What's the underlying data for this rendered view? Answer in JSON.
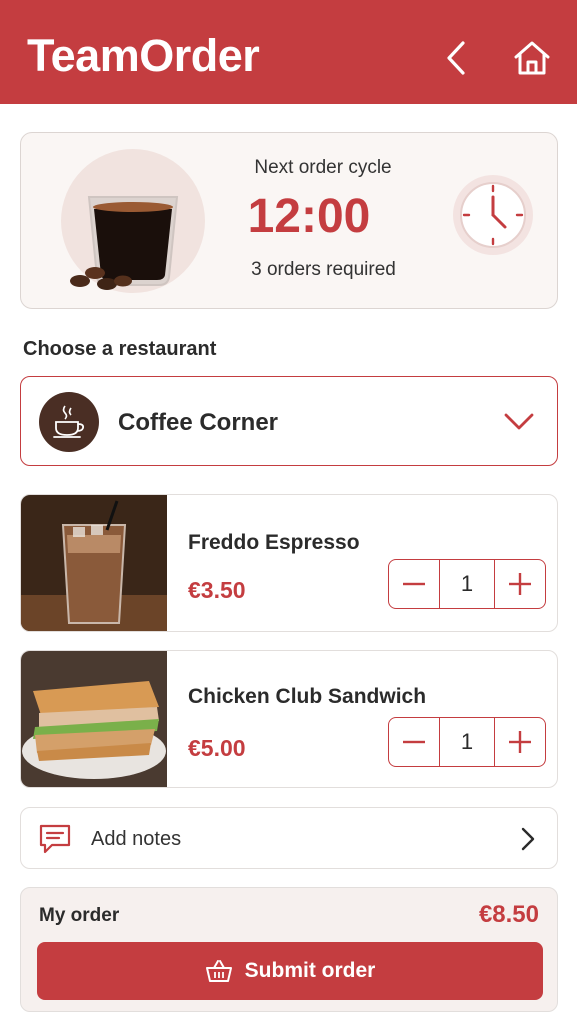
{
  "header": {
    "title": "TeamOrder",
    "back_icon": "chevron-left-icon",
    "home_icon": "home-icon",
    "color": "#c43d40"
  },
  "cycle": {
    "label": "Next order cycle",
    "time": "12:00",
    "orders_required": "3 orders required"
  },
  "restaurant": {
    "section_label": "Choose a restaurant",
    "selected": "Coffee Corner",
    "icon": "coffee-cup-icon"
  },
  "items": [
    {
      "name": "Freddo Espresso",
      "price": "€3.50",
      "quantity": "1"
    },
    {
      "name": "Chicken Club Sandwich",
      "price": "€5.00",
      "quantity": "1"
    }
  ],
  "notes": {
    "label": "Add notes",
    "icon": "message-icon"
  },
  "order": {
    "label": "My order",
    "total": "€8.50",
    "submit_label": "Submit order",
    "submit_icon": "basket-icon"
  },
  "colors": {
    "accent": "#c43d40",
    "card_bg": "#faf6f4",
    "coffee_brown": "#4a2e24"
  }
}
